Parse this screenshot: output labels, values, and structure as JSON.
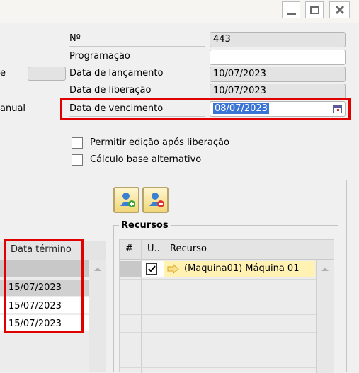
{
  "form": {
    "left_labels": {
      "partial_e": "e",
      "partial_manual": "anual"
    },
    "fields": [
      {
        "label": "Nº",
        "value": "443"
      },
      {
        "label": "Programação",
        "value": ""
      },
      {
        "label": "Data de lançamento",
        "value": "10/07/2023"
      },
      {
        "label": "Data de liberação",
        "value": "10/07/2023"
      },
      {
        "label": "Data de vencimento",
        "value": "08/07/2023"
      }
    ],
    "checkboxes": [
      {
        "label": "Permitir edição após liberação",
        "checked": false
      },
      {
        "label": "Cálculo base alternativo",
        "checked": false
      }
    ]
  },
  "left_grid": {
    "column_header": "Data término",
    "rows": [
      "15/07/2023",
      "15/07/2023",
      "15/07/2023"
    ]
  },
  "resources": {
    "title": "Recursos",
    "columns": [
      "#",
      "U..",
      "Recurso"
    ],
    "rows": [
      {
        "checked": true,
        "resource": "(Maquina01) Máquina 01"
      }
    ]
  },
  "colors": {
    "highlight_red": "#e00000",
    "selection_blue": "#3a75d6",
    "row_highlight": "#fff2b3"
  }
}
